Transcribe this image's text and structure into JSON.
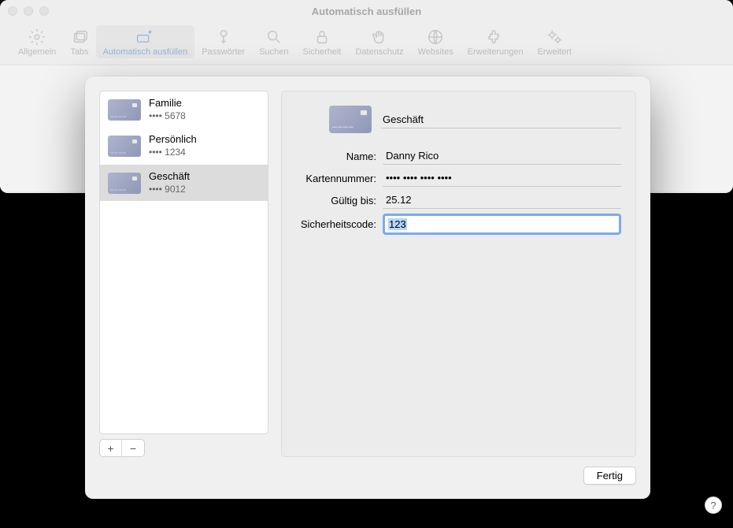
{
  "window": {
    "title": "Automatisch ausfüllen"
  },
  "toolbar": {
    "items": [
      {
        "label": "Allgemein"
      },
      {
        "label": "Tabs"
      },
      {
        "label": "Automatisch ausfüllen"
      },
      {
        "label": "Passwörter"
      },
      {
        "label": "Suchen"
      },
      {
        "label": "Sicherheit"
      },
      {
        "label": "Datenschutz"
      },
      {
        "label": "Websites"
      },
      {
        "label": "Erweiterungen"
      },
      {
        "label": "Erweitert"
      }
    ]
  },
  "help_label": "?",
  "cards": [
    {
      "name": "Familie",
      "digits": "•••• 5678"
    },
    {
      "name": "Persönlich",
      "digits": "•••• 1234"
    },
    {
      "name": "Geschäft",
      "digits": "•••• 9012"
    }
  ],
  "add_label": "+",
  "remove_label": "−",
  "detail": {
    "title": "Geschäft",
    "name_label": "Name:",
    "name_value": "Danny Rico",
    "number_label": "Kartennummer:",
    "number_value": "•••• •••• •••• ••••",
    "valid_label": "Gültig bis:",
    "valid_value": "25.12",
    "cvc_label": "Sicherheitscode:",
    "cvc_value": "123"
  },
  "done_label": "Fertig"
}
